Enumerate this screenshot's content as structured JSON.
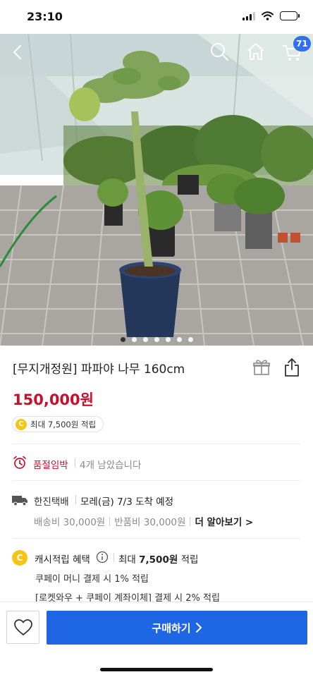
{
  "status_bar": {
    "time": "23:10"
  },
  "header": {
    "cart_count": "71"
  },
  "hero": {
    "image_index": 1,
    "image_count": 7
  },
  "product": {
    "title": "[무지개정원] 파파야 나무 160cm",
    "price": "150,000원",
    "reward": "최대 7,500원 적립"
  },
  "stock": {
    "label": "품절임박",
    "text": "4개 남았습니다"
  },
  "delivery": {
    "carrier": "한진택배",
    "arrival": "모레(금) 7/3 도착 예정",
    "shipping_fee": "배송비 30,000원",
    "return_fee": "반품비 30,000원",
    "more": "더 알아보기 >"
  },
  "cashback": {
    "coin": "C",
    "title": "캐시적립 혜택",
    "max_prefix": "최대",
    "max_amount": "7,500원",
    "max_suffix": "적립",
    "line1": "쿠페이 머니 결제 시 1% 적립",
    "line2": "[로켓와우 + 쿠페이 계좌이체] 결제 시 2% 적립"
  },
  "bottom": {
    "buy_label": "구매하기"
  },
  "colors": {
    "price": "#c8102e",
    "accent": "#1f66e5",
    "coin": "#f7c413",
    "badge": "#2f6ff0"
  },
  "icons": [
    "back-icon",
    "search-icon",
    "home-icon",
    "cart-icon",
    "gift-icon",
    "share-icon",
    "alarm-clock-icon",
    "truck-icon",
    "info-icon",
    "heart-icon",
    "chevron-right-icon"
  ]
}
